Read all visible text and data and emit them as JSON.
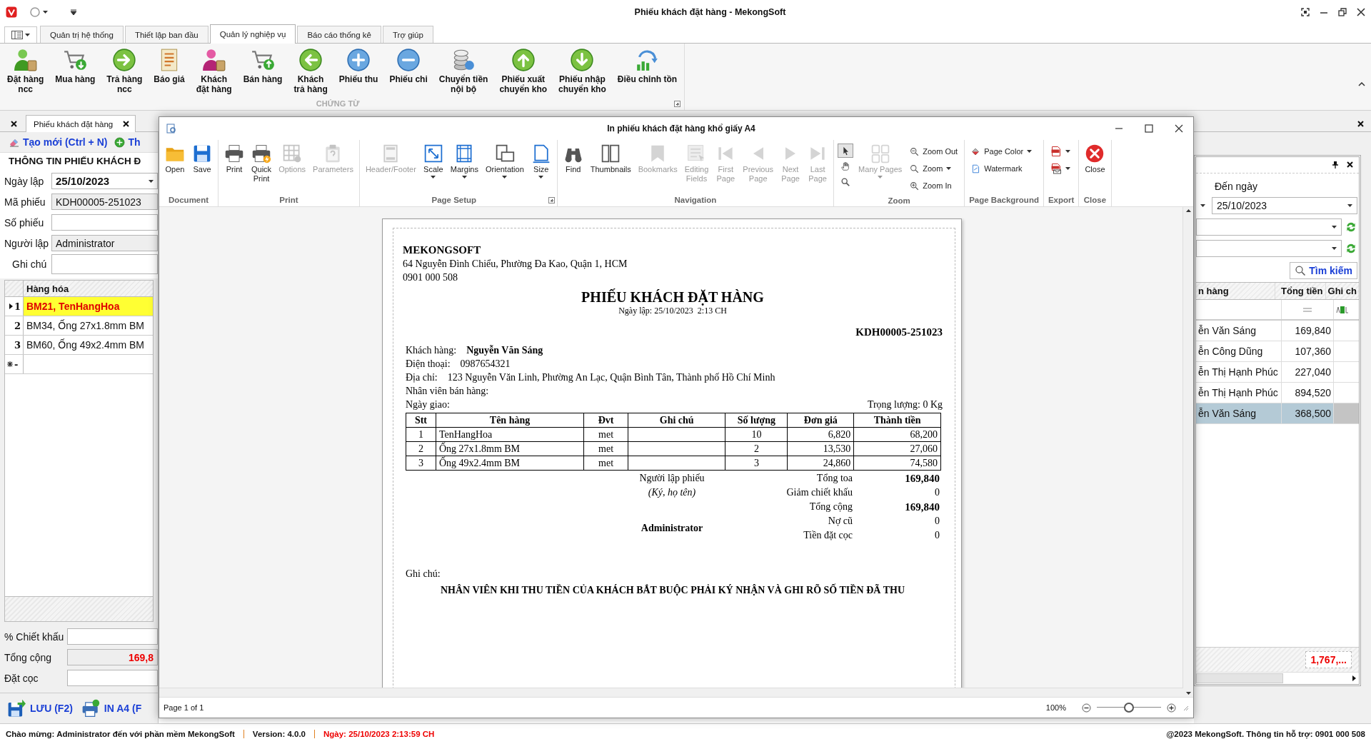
{
  "app": {
    "title": "Phiếu khách đặt hàng - MekongSoft"
  },
  "main_ribbon": {
    "tabs": [
      {
        "label": "Quản trị hệ thống",
        "selected": false
      },
      {
        "label": "Thiết lập ban đầu",
        "selected": false
      },
      {
        "label": "Quản lý nghiệp vụ",
        "selected": true
      },
      {
        "label": "Báo cáo thống kê",
        "selected": false
      },
      {
        "label": "Trợ giúp",
        "selected": false
      }
    ],
    "buttons": [
      {
        "label": "Đặt hàng\nncc"
      },
      {
        "label": "Mua hàng"
      },
      {
        "label": "Trả hàng\nncc"
      },
      {
        "label": "Báo giá"
      },
      {
        "label": "Khách\nđặt hàng"
      },
      {
        "label": "Bán hàng"
      },
      {
        "label": "Khách\ntrả hàng"
      },
      {
        "label": "Phiếu thu"
      },
      {
        "label": "Phiếu chi"
      },
      {
        "label": "Chuyển tiền\nnội bộ"
      },
      {
        "label": "Phiếu xuất\nchuyển kho"
      },
      {
        "label": "Phiếu nhập\nchuyển kho"
      },
      {
        "label": "Điều chỉnh tồn"
      }
    ],
    "group": "CHỨNG TỪ"
  },
  "doc_tab": {
    "label": "Phiếu khách đặt hàng"
  },
  "order_form": {
    "toolbar": [
      "Tạo mới (Ctrl + N)",
      "Th"
    ],
    "section_title": "THÔNG TIN PHIẾU KHÁCH Đ",
    "fields": [
      {
        "label": "Ngày lập",
        "value": "25/10/2023",
        "kind": "date"
      },
      {
        "label": "Mã phiếu",
        "value": "KDH00005-251023",
        "kind": "readonly"
      },
      {
        "label": "Số phiếu",
        "kind": "text"
      },
      {
        "label": "Người lập",
        "value": "Administrator",
        "kind": "readonly"
      },
      {
        "label": "Ghi chú",
        "kind": "memo"
      }
    ],
    "grid": {
      "column": "Hàng hóa",
      "rows": [
        {
          "index": "1",
          "item": "BM21, TenHangHoa",
          "selected": true
        },
        {
          "index": "2",
          "item": "BM34, Ống 27x1.8mm BM",
          "selected": false
        },
        {
          "index": "3",
          "item": "BM60, Ống 49x2.4mm BM",
          "selected": false
        }
      ],
      "new_row": "-"
    },
    "totals": [
      {
        "label": "% Chiết khấu",
        "kind": "text"
      },
      {
        "label": "Tổng cộng",
        "value": "169,8",
        "kind": "readonly"
      },
      {
        "label": "Đặt cọc",
        "kind": "text"
      }
    ],
    "actions": [
      "LƯU (F2)",
      "IN A4 (F"
    ]
  },
  "order_list": {
    "date_label": "Đến ngày",
    "date_value": "25/10/2023",
    "search_button": "Tìm kiếm",
    "columns": [
      "n hàng",
      "Tổng tiền",
      "Ghi ch"
    ],
    "rows": [
      {
        "customer": "ễn Văn Sáng",
        "total": "169,840",
        "selected": false
      },
      {
        "customer": "ễn Công Dũng",
        "total": "107,360",
        "selected": false
      },
      {
        "customer": "ễn Thị Hạnh Phúc",
        "total": "227,040",
        "selected": false
      },
      {
        "customer": "ễn Thị Hạnh Phúc",
        "total": "894,520",
        "selected": false
      },
      {
        "customer": "ễn Văn Sáng",
        "total": "368,500",
        "selected": true
      }
    ],
    "footer_total": "1,767,..."
  },
  "preview": {
    "title": "In phiếu khách đặt hàng khổ giấy A4",
    "groups": [
      {
        "label": "Document",
        "items": [
          {
            "kind": "large",
            "label": "Open",
            "disabled": false,
            "dropdown": false
          },
          {
            "kind": "large",
            "label": "Save",
            "disabled": false,
            "dropdown": false
          }
        ]
      },
      {
        "label": "Print",
        "items": [
          {
            "kind": "large",
            "label": "Print",
            "disabled": false,
            "dropdown": false
          },
          {
            "kind": "large",
            "label": "Quick\nPrint",
            "disabled": false,
            "dropdown": false
          },
          {
            "kind": "large",
            "label": "Options",
            "disabled": true,
            "dropdown": false
          },
          {
            "kind": "large",
            "label": "Parameters",
            "disabled": true,
            "dropdown": false
          }
        ]
      },
      {
        "label": "Page Setup",
        "items": [
          {
            "kind": "large",
            "label": "Header/Footer",
            "disabled": true,
            "dropdown": false
          },
          {
            "kind": "large",
            "label": "Scale",
            "disabled": false,
            "dropdown": true
          },
          {
            "kind": "large",
            "label": "Margins",
            "disabled": false,
            "dropdown": true
          },
          {
            "kind": "large",
            "label": "Orientation",
            "disabled": false,
            "dropdown": true
          },
          {
            "kind": "large",
            "label": "Size",
            "disabled": false,
            "dropdown": true
          }
        ]
      },
      {
        "label": "Navigation",
        "items": [
          {
            "kind": "large",
            "label": "Find",
            "disabled": false,
            "dropdown": false
          },
          {
            "kind": "large",
            "label": "Thumbnails",
            "disabled": false,
            "dropdown": false
          },
          {
            "kind": "large",
            "label": "Bookmarks",
            "disabled": true,
            "dropdown": false
          },
          {
            "kind": "large",
            "label": "Editing\nFields",
            "disabled": true,
            "dropdown": false
          },
          {
            "kind": "large",
            "label": "First\nPage",
            "disabled": true,
            "dropdown": false
          },
          {
            "kind": "large",
            "label": "Previous\nPage",
            "disabled": true,
            "dropdown": false
          },
          {
            "kind": "large",
            "label": "Next\nPage",
            "disabled": true,
            "dropdown": false
          },
          {
            "kind": "large",
            "label": "Last\nPage",
            "disabled": true,
            "dropdown": false
          }
        ]
      },
      {
        "label": "Zoom",
        "items": [
          {
            "kind": "tools",
            "tools": [
              {
                "selected": true
              },
              {
                "selected": false
              },
              {
                "selected": false
              }
            ]
          },
          {
            "kind": "large",
            "label": "Many Pages",
            "disabled": true,
            "dropdown": true
          },
          {
            "kind": "stack",
            "items": [
              {
                "label": "Zoom Out",
                "disabled": false,
                "dropdown": false
              },
              {
                "label": "Zoom",
                "disabled": false,
                "dropdown": true
              },
              {
                "label": "Zoom In",
                "disabled": false,
                "dropdown": false
              }
            ]
          }
        ]
      },
      {
        "label": "Page Background",
        "items": [
          {
            "kind": "stack",
            "items": [
              {
                "label": "Page Color",
                "disabled": false,
                "dropdown": true
              },
              {
                "label": "Watermark",
                "disabled": false,
                "dropdown": false
              }
            ]
          }
        ]
      },
      {
        "label": "Export",
        "items": [
          {
            "kind": "stack",
            "items": [
              {
                "disabled": false,
                "dropdown": true
              },
              {
                "disabled": false,
                "dropdown": true
              }
            ]
          }
        ]
      },
      {
        "label": "Close",
        "items": [
          {
            "kind": "large",
            "label": "Close",
            "disabled": false,
            "dropdown": false
          }
        ]
      }
    ],
    "page_status": "Page 1 of 1",
    "zoom_text": "100%",
    "zoom_slider": {
      "level": 0.5
    }
  },
  "report": {
    "company": "MEKONGSOFT",
    "address": "64 Nguyễn Đình Chiểu, Phường Đa Kao, Quận 1, HCM",
    "phone": "0901 000 508",
    "title": "PHIẾU KHÁCH ĐẶT HÀNG",
    "date_line": "Ngày lập: 25/10/2023  2:13 CH",
    "code": "KDH00005-251023",
    "info": [
      {
        "label": "Khách hàng:",
        "value": "Nguyễn Văn Sáng"
      },
      {
        "label": "Điện thoại:",
        "value": "0987654321"
      },
      {
        "label": "Địa chỉ:",
        "value": "123 Nguyễn Văn Linh, Phường An Lạc, Quận Bình Tân, Thành phố Hồ Chí Minh"
      },
      {
        "label": "Nhân viên bán hàng:"
      }
    ],
    "delivery_label": "Ngày giao:",
    "weight": "Trọng lượng: 0 Kg",
    "columns": [
      "Stt",
      "Tên hàng",
      "Đvt",
      "Ghi chú",
      "Số lượng",
      "Đơn giá",
      "Thành tiền"
    ],
    "rows": [
      {
        "stt": "1",
        "name": "TenHangHoa",
        "unit": "met",
        "qty": "10",
        "price": "6,820",
        "amount": "68,200"
      },
      {
        "stt": "2",
        "name": "Ống 27x1.8mm BM",
        "unit": "met",
        "qty": "2",
        "price": "13,530",
        "amount": "27,060"
      },
      {
        "stt": "3",
        "name": "Ống 49x2.4mm BM",
        "unit": "met",
        "qty": "3",
        "price": "24,860",
        "amount": "74,580"
      }
    ],
    "signer_label": "Người lập phiếu",
    "signer_hint": "(Ký, họ tên)",
    "signer_name": "Administrator",
    "summary": [
      {
        "label": "Tổng toa",
        "value": "169,840",
        "bold": true
      },
      {
        "label": "Giảm chiết khấu",
        "value": "0",
        "bold": false
      },
      {
        "label": "Tổng cộng",
        "value": "169,840",
        "bold": true
      },
      {
        "label": "Nợ cũ",
        "value": "0",
        "bold": false
      },
      {
        "label": "Tiền đặt cọc",
        "value": "0",
        "bold": false
      }
    ],
    "note_label": "Ghi chú:",
    "note": "NHÂN VIÊN KHI THU TIỀN CỦA KHÁCH BẮT BUỘC PHẢI KÝ NHẬN VÀ GHI RÕ SỐ TIỀN ĐÃ THU"
  },
  "status_bar": {
    "welcome": "Chào mừng: Administrator đến với phần mềm MekongSoft",
    "version": "Version: 4.0.0",
    "date": "Ngày: 25/10/2023 2:13:59 CH",
    "copyright": "@2023 MekongSoft. Thông tin hỗ trợ: 0901 000 508"
  }
}
